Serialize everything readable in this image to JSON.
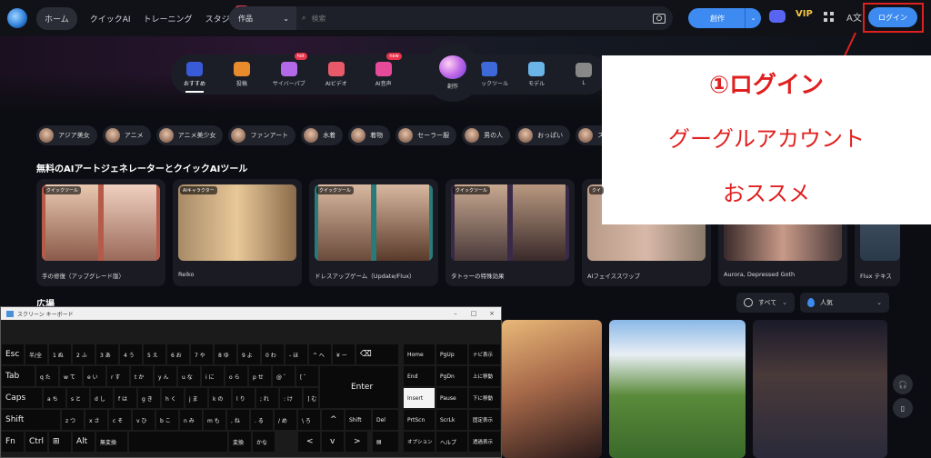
{
  "topbar": {
    "nav": [
      "ホーム",
      "クイックAI",
      "トレーニング",
      "スタジオ"
    ],
    "hot_badge": "hot",
    "search_type": "作品",
    "search_placeholder": "検索",
    "create_label": "創作",
    "vip_label": "VIP",
    "login_label": "ログイン"
  },
  "features": [
    {
      "label": "おすすめ",
      "color": "#3a5bd8"
    },
    {
      "label": "投稿",
      "color": "#e88b2c"
    },
    {
      "label": "サイバーパブ",
      "color": "#b46ae8",
      "badge": "hot"
    },
    {
      "label": "AIビデオ",
      "color": "#e85a6a"
    },
    {
      "label": "AI音声",
      "color": "#e84a9a",
      "badge": "new"
    }
  ],
  "features_right": [
    {
      "label": "クイックツール",
      "color": "#3d6ad8"
    },
    {
      "label": "モデル",
      "color": "#6ab4e8"
    },
    {
      "label": "L",
      "color": "#888888"
    }
  ],
  "center_create": "創作",
  "tags": [
    "アジア美女",
    "アニメ",
    "アニメ美少女",
    "ファンアート",
    "水着",
    "着物",
    "セーラー服",
    "男の人",
    "おっぱい",
    "ス"
  ],
  "section_title": "無料のAIアートジェネレーターとクイックAIツール",
  "cards": [
    {
      "badge": "クイックツール",
      "label": "手の修復（アップグレード版）",
      "tone": "#c89a88"
    },
    {
      "badge": "AIキャラクター",
      "label": "Reiko",
      "tone": "#c8a878"
    },
    {
      "badge": "クイックツール",
      "label": "ドレスアップゲーム（Update/Flux）",
      "tone": "#3a8a8a"
    },
    {
      "badge": "クイックツール",
      "label": "タトゥーの特殊効果",
      "tone": "#6a5a5a"
    },
    {
      "badge": "クイ",
      "label": "AIフェイススワップ",
      "tone": "#8a7a6a"
    },
    {
      "badge": "",
      "label": "Aurora, Depressed Goth",
      "tone": "#5a4a4a"
    },
    {
      "badge": "",
      "label": "Flux テキス",
      "tone": "#4a5a6a"
    }
  ],
  "plaza_title": "広場",
  "filters": {
    "time": "すべて",
    "sort": "人気"
  },
  "annotation": {
    "line1": "①ログイン",
    "line2": "グーグルアカウント",
    "line3": "おススメ"
  },
  "osk": {
    "title": "スクリーン キーボード",
    "rows": [
      [
        "Esc",
        "半/全",
        "1 ぬ",
        "2 ふ",
        "3 あ",
        "4 う",
        "5 え",
        "6 お",
        "7 や",
        "8 ゆ",
        "9 よ",
        "0 わ",
        "- ほ",
        "^ へ",
        "¥ ー",
        "⌫",
        "Home",
        "PgUp",
        "ナビ表示"
      ],
      [
        "Tab",
        "q た",
        "w て",
        "e い",
        "r す",
        "t か",
        "y ん",
        "u な",
        "i に",
        "o ら",
        "p せ",
        "@ ゛",
        "[ ゜",
        "Enter",
        "End",
        "PgDn",
        "上に移動"
      ],
      [
        "Caps",
        "a ち",
        "s と",
        "d し",
        "f は",
        "g き",
        "h く",
        "j ま",
        "k の",
        "l り",
        "; れ",
        ": け",
        "] む",
        "Insert",
        "Pause",
        "下に移動"
      ],
      [
        "Shift",
        "z つ",
        "x さ",
        "c そ",
        "v ひ",
        "b こ",
        "n み",
        "m も",
        ", ね",
        ". る",
        "/ め",
        "\\ ろ",
        "^",
        "Shift",
        "Del",
        "PrtScn",
        "ScrLk",
        "固定表示"
      ],
      [
        "Fn",
        "Ctrl",
        "⊞",
        "Alt",
        "無変換",
        "",
        "変換",
        "かな",
        "<",
        "v",
        ">",
        "▤",
        "オプション",
        "ヘルプ",
        "透過表示"
      ]
    ]
  }
}
